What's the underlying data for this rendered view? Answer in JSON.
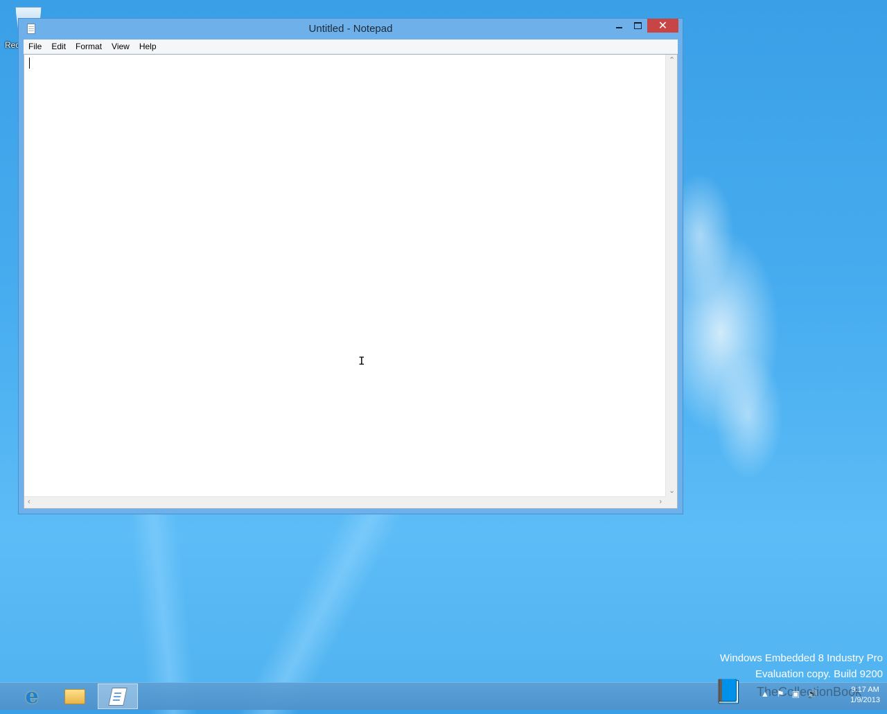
{
  "desktop": {
    "recycle_bin_label": "Rec"
  },
  "window": {
    "title": "Untitled - Notepad",
    "minimize_label": "",
    "maximize_label": "",
    "close_label": "✕"
  },
  "menu": {
    "items": [
      "File",
      "Edit",
      "Format",
      "View",
      "Help"
    ]
  },
  "editor": {
    "content": ""
  },
  "watermark": {
    "line1": "Windows Embedded 8 Industry Pro",
    "line2": "Evaluation copy. Build 9200"
  },
  "taskbar": {
    "ie_glyph": "e",
    "logo_text": "TheCollectionBook"
  },
  "clock": {
    "time": "9:17 AM",
    "date": "1/9/2013"
  },
  "icons": {
    "recycle_bin": "recycle-bin-icon",
    "notepad": "notepad-icon",
    "ie": "internet-explorer-icon",
    "explorer": "file-explorer-icon"
  }
}
